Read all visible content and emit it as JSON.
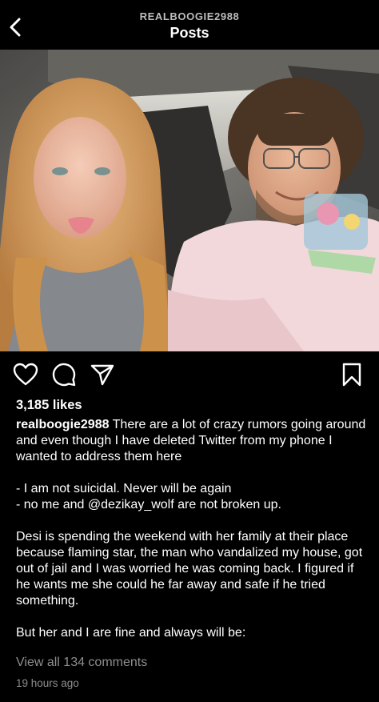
{
  "header": {
    "username": "REALBOOGIE2988",
    "title": "Posts"
  },
  "post": {
    "likes": "3,185 likes",
    "author": "realboogie2988",
    "caption": " There are a lot of crazy rumors going around and even though I have deleted Twitter from my phone I wanted to address them here\n\n- I am not suicidal. Never will be again\n- no me and @dezikay_wolf are not broken up.\n\nDesi is spending the weekend with her family at their place because flaming star, the man who vandalized my house, got out of jail and I was worried he was coming back. I figured if he wants me she could he far away and safe if he tried something.\n\nBut her and I are fine and always will be:",
    "view_comments": "View all 134 comments",
    "timestamp": "19 hours ago"
  },
  "icons": {
    "back": "chevron-left-icon",
    "like": "heart-icon",
    "comment": "comment-icon",
    "share": "send-icon",
    "save": "bookmark-icon"
  },
  "colors": {
    "background": "#000000",
    "secondary_text": "#8e8e8e"
  }
}
